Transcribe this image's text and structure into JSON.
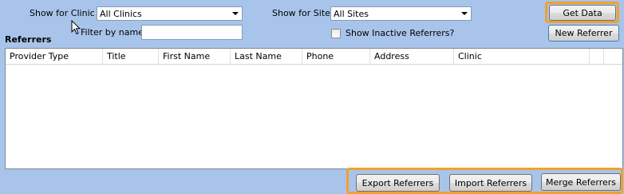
{
  "filters": {
    "clinic_label": "Show for Clinic",
    "clinic_value": "All Clinics",
    "site_label": "Show for Site",
    "site_value": "All Sites",
    "name_label": "Filter by name",
    "name_value": "",
    "show_inactive_label": "Show Inactive Referrers?",
    "show_inactive_checked": false
  },
  "actions": {
    "get_data": "Get Data",
    "new_referrer": "New Referrer",
    "export": "Export Referrers",
    "import": "Import Referrers",
    "merge": "Merge Referrers"
  },
  "section_title": "Referrers",
  "table": {
    "columns": [
      "Provider Type",
      "Title",
      "First Name",
      "Last Name",
      "Phone",
      "Address",
      "Clinic",
      "",
      ""
    ],
    "rows": []
  },
  "colors": {
    "background": "#a9c4ea",
    "highlight": "#f0a030"
  }
}
